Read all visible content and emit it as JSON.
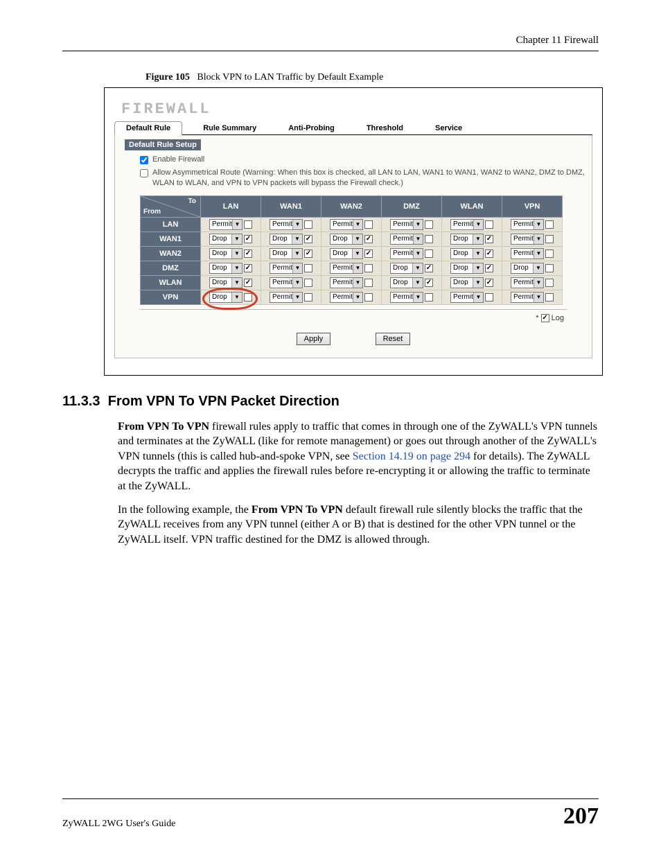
{
  "chapter": "Chapter 11 Firewall",
  "figure": {
    "label": "Figure 105",
    "caption": "Block VPN to LAN Traffic by Default Example"
  },
  "firewall": {
    "title": "FIREWALL",
    "tabs": [
      "Default Rule",
      "Rule Summary",
      "Anti-Probing",
      "Threshold",
      "Service"
    ],
    "active_tab": 0,
    "section_bar": "Default Rule Setup",
    "enable_label": "Enable Firewall",
    "enable_checked": true,
    "asym_label": "Allow Asymmetrical Route (Warning: When this box is checked, all LAN to LAN, WAN1 to WAN1, WAN2 to WAN2, DMZ to DMZ, WLAN to WLAN, and VPN to VPN packets will bypass the Firewall check.)",
    "asym_checked": false,
    "corner_to": "To",
    "corner_from": "From",
    "cols": [
      "LAN",
      "WAN1",
      "WAN2",
      "DMZ",
      "WLAN",
      "VPN"
    ],
    "rows": [
      "LAN",
      "WAN1",
      "WAN2",
      "DMZ",
      "WLAN",
      "VPN"
    ],
    "cells": [
      [
        {
          "v": "Permit",
          "c": false
        },
        {
          "v": "Permit",
          "c": false
        },
        {
          "v": "Permit",
          "c": false
        },
        {
          "v": "Permit",
          "c": false
        },
        {
          "v": "Permit",
          "c": false
        },
        {
          "v": "Permit",
          "c": false
        }
      ],
      [
        {
          "v": "Drop",
          "c": true
        },
        {
          "v": "Drop",
          "c": true
        },
        {
          "v": "Drop",
          "c": true
        },
        {
          "v": "Permit",
          "c": false
        },
        {
          "v": "Drop",
          "c": true
        },
        {
          "v": "Permit",
          "c": false
        }
      ],
      [
        {
          "v": "Drop",
          "c": true
        },
        {
          "v": "Drop",
          "c": true
        },
        {
          "v": "Drop",
          "c": true
        },
        {
          "v": "Permit",
          "c": false
        },
        {
          "v": "Drop",
          "c": true
        },
        {
          "v": "Permit",
          "c": false
        }
      ],
      [
        {
          "v": "Drop",
          "c": true
        },
        {
          "v": "Permit",
          "c": false
        },
        {
          "v": "Permit",
          "c": false
        },
        {
          "v": "Drop",
          "c": true
        },
        {
          "v": "Drop",
          "c": true
        },
        {
          "v": "Drop",
          "c": false
        }
      ],
      [
        {
          "v": "Drop",
          "c": true
        },
        {
          "v": "Permit",
          "c": false
        },
        {
          "v": "Permit",
          "c": false
        },
        {
          "v": "Drop",
          "c": true
        },
        {
          "v": "Drop",
          "c": true
        },
        {
          "v": "Permit",
          "c": false
        }
      ],
      [
        {
          "v": "Drop",
          "c": false
        },
        {
          "v": "Permit",
          "c": false
        },
        {
          "v": "Permit",
          "c": false
        },
        {
          "v": "Permit",
          "c": false
        },
        {
          "v": "Permit",
          "c": false
        },
        {
          "v": "Permit",
          "c": false
        }
      ]
    ],
    "log_star": "*",
    "log_label": "Log",
    "log_checked": true,
    "apply": "Apply",
    "reset": "Reset"
  },
  "section": {
    "number": "11.3.3",
    "title": "From VPN To VPN Packet Direction",
    "p1a": "From VPN To VPN",
    "p1b": " firewall rules apply to traffic that comes in through one of the ZyWALL's VPN tunnels and terminates at the ZyWALL (like for remote management) or goes out through another of the ZyWALL's VPN tunnels (this is called hub-and-spoke VPN, see ",
    "p1link": "Section 14.19 on page 294",
    "p1c": " for details). The ZyWALL decrypts the traffic and applies the firewall rules before re-encrypting it or allowing the traffic to terminate at the ZyWALL.",
    "p2a": "In the following example, the ",
    "p2b": "From VPN To VPN",
    "p2c": " default firewall rule silently blocks the traffic that the ZyWALL receives from any VPN tunnel (either A or B) that is destined for the other VPN tunnel or the ZyWALL itself. VPN traffic destined for the DMZ is allowed through."
  },
  "footer": {
    "guide": "ZyWALL 2WG User's Guide",
    "page": "207"
  }
}
